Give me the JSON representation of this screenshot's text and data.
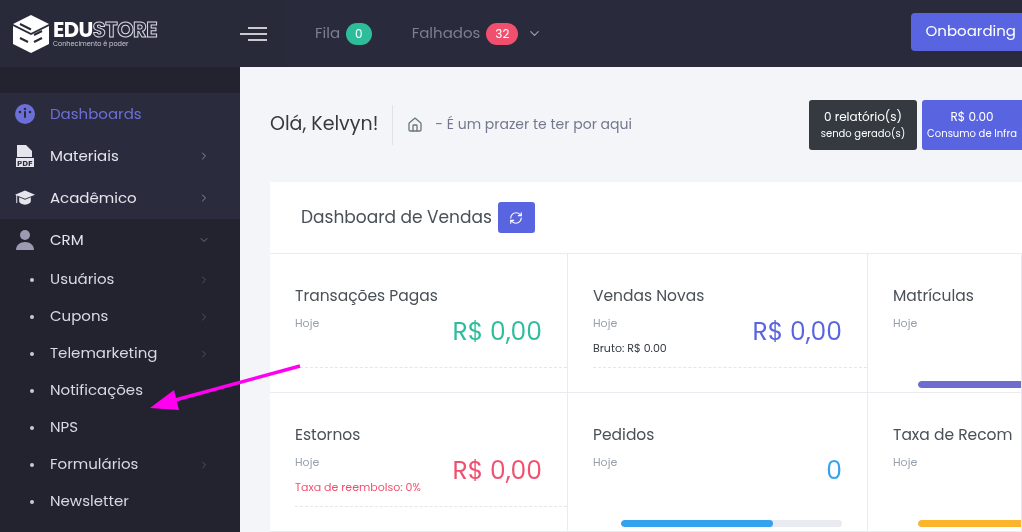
{
  "header": {
    "logo": {
      "brand_primary": "EDU",
      "brand_secondary": "STORE",
      "tagline": "Conhecimento é poder"
    },
    "queues": [
      {
        "label": "Fila",
        "count": "0",
        "color": "#2ebd9b",
        "has_menu": false
      },
      {
        "label": "Falhados",
        "count": "32",
        "color": "#f0506e",
        "has_menu": true
      }
    ],
    "onboarding_button": {
      "label": "Onboarding"
    }
  },
  "sidebar": {
    "items": [
      {
        "label": "Dashboards",
        "kind": "gauge",
        "selected": true,
        "expandable": false,
        "expanded": false
      },
      {
        "label": "Materiais",
        "kind": "pdf",
        "icon_label": "PDF",
        "selected": false,
        "expandable": true,
        "expanded": false
      },
      {
        "label": "Acadêmico",
        "kind": "cap",
        "selected": false,
        "expandable": true,
        "expanded": false
      },
      {
        "label": "CRM",
        "kind": "user",
        "selected": false,
        "expandable": true,
        "expanded": true,
        "children": [
          {
            "label": "Usuários",
            "expandable": true
          },
          {
            "label": "Cupons",
            "expandable": true
          },
          {
            "label": "Telemarketing",
            "expandable": true
          },
          {
            "label": "Notificações",
            "expandable": false
          },
          {
            "label": "NPS",
            "expandable": false
          },
          {
            "label": "Formulários",
            "expandable": true
          },
          {
            "label": "Newsletter",
            "expandable": false
          }
        ]
      }
    ]
  },
  "page": {
    "greeting": "Olá, Kelvyn!",
    "breadcrumb": "- É um prazer te ter por aqui",
    "reports": {
      "line_1": "0 relatório(s)",
      "line_2": "sendo gerado(s)"
    },
    "infra": {
      "value": "R$ 0.00",
      "label": "Consumo de Infra"
    }
  },
  "dashboard": {
    "title": "Dashboard de Vendas",
    "cards": [
      {
        "title": "Transações Pagas",
        "period": "Hoje",
        "value": "R$ 0,00",
        "color": "#2ebd9b"
      },
      {
        "title": "Vendas Novas",
        "period": "Hoje",
        "value": "R$ 0,00",
        "color": "#5965e0",
        "note": "Bruto: R$ 0.00",
        "alert": false
      },
      {
        "title": "Matrículas",
        "period": "Hoje",
        "color": "#6f6ccf",
        "level": 1
      },
      {
        "title": "Estornos",
        "period": "Hoje",
        "value": "R$ 0,00",
        "color": "#f0506e",
        "note": "Taxa de reembolso: 0%",
        "alert": true
      },
      {
        "title": "Pedidos",
        "period": "Hoje",
        "value": "0",
        "color": "#35a2f0",
        "level": 0.69
      },
      {
        "title": "Taxa de Recom",
        "period": "Hoje",
        "color": "#fbb42b",
        "level": 1
      }
    ]
  },
  "annotation": {
    "kind": "arrow"
  }
}
